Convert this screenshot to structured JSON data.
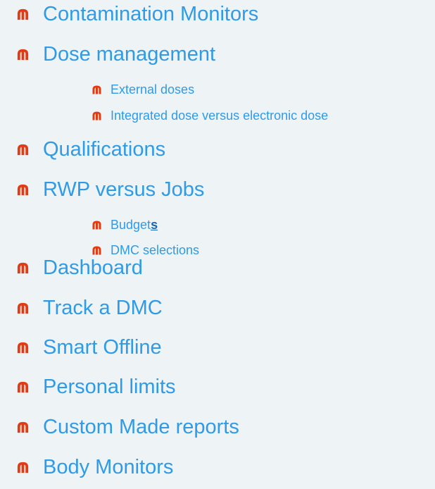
{
  "colors": {
    "background": "#eef3f6",
    "text": "#2f9be6",
    "bullet": "#e23b14",
    "link": "#1565b8"
  },
  "bullet_icon": "m-icon",
  "items": [
    {
      "label": "Contamination Monitors"
    },
    {
      "label": "Dose management"
    },
    {
      "label": "External doses"
    },
    {
      "label": "Integrated dose versus electronic dose"
    },
    {
      "label": "Qualifications"
    },
    {
      "label": "RWP versus Jobs"
    },
    {
      "label_prefix": "Budget",
      "label_link": "s"
    },
    {
      "label": "DMC selections"
    },
    {
      "label": "Dashboard"
    },
    {
      "label": "Track a DMC"
    },
    {
      "label": "Smart Offline"
    },
    {
      "label": "Personal limits"
    },
    {
      "label": "Custom Made reports"
    },
    {
      "label": "Body Monitors"
    }
  ]
}
